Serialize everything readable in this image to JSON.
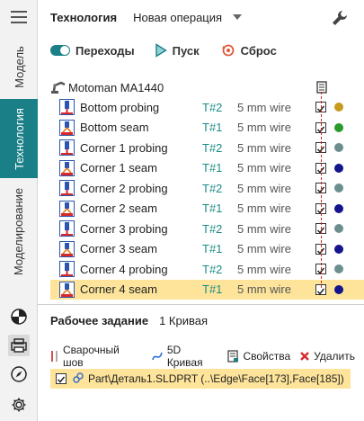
{
  "sidebar": {
    "tabs": [
      {
        "label": "Модель",
        "active": false
      },
      {
        "label": "Технология",
        "active": true
      },
      {
        "label": "Моделирование",
        "active": false
      }
    ],
    "icons": [
      "sphere-icon",
      "printer-icon",
      "compass-icon",
      "gear-icon"
    ]
  },
  "header": {
    "title": "Технология",
    "operation": "Новая операция"
  },
  "toolbar": {
    "transitions": "Переходы",
    "start": "Пуск",
    "reset": "Сброс"
  },
  "robot": {
    "name": "Motoman MA1440"
  },
  "operations": [
    {
      "name": "Bottom probing",
      "tool": "T#2",
      "wire": "5 mm wire",
      "kind": "probing",
      "color": "#c79a1e",
      "selected": false
    },
    {
      "name": "Bottom seam",
      "tool": "T#1",
      "wire": "5 mm wire",
      "kind": "seam",
      "color": "#2a9a2a",
      "selected": false
    },
    {
      "name": "Corner 1 probing",
      "tool": "T#2",
      "wire": "5 mm wire",
      "kind": "probing",
      "color": "#6b8f8e",
      "selected": false
    },
    {
      "name": "Corner 1 seam",
      "tool": "T#1",
      "wire": "5 mm wire",
      "kind": "seam",
      "color": "#14148c",
      "selected": false
    },
    {
      "name": "Corner 2 probing",
      "tool": "T#2",
      "wire": "5 mm wire",
      "kind": "probing",
      "color": "#6b8f8e",
      "selected": false
    },
    {
      "name": "Corner 2 seam",
      "tool": "T#1",
      "wire": "5 mm wire",
      "kind": "seam",
      "color": "#14148c",
      "selected": false
    },
    {
      "name": "Corner 3 probing",
      "tool": "T#2",
      "wire": "5 mm wire",
      "kind": "probing",
      "color": "#6b8f8e",
      "selected": false
    },
    {
      "name": "Corner 3 seam",
      "tool": "T#1",
      "wire": "5 mm wire",
      "kind": "seam",
      "color": "#14148c",
      "selected": false
    },
    {
      "name": "Corner 4 probing",
      "tool": "T#2",
      "wire": "5 mm wire",
      "kind": "probing",
      "color": "#6b8f8e",
      "selected": false
    },
    {
      "name": "Corner 4 seam",
      "tool": "T#1",
      "wire": "5 mm wire",
      "kind": "seam",
      "color": "#14148c",
      "selected": true
    }
  ],
  "task": {
    "title": "Рабочее задание",
    "count": "1 Кривая",
    "tools": {
      "weld": "Сварочный шов",
      "curve": "5D Кривая",
      "props": "Свойства",
      "delete": "Удалить"
    },
    "item": "Part\\Деталь1.SLDPRT (..\\Edge\\Face[173],Face[185])"
  }
}
